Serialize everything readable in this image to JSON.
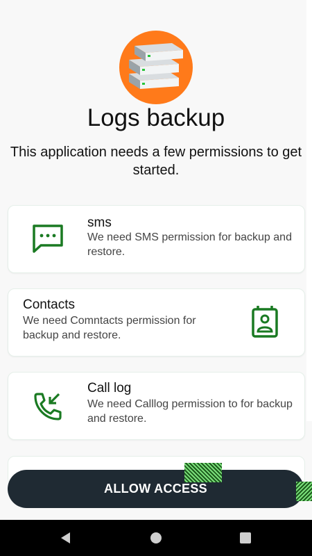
{
  "header": {
    "title": "Logs backup",
    "subtitle": "This application needs a few  permissions to get started.",
    "logo_icon": "server-stack-icon",
    "logo_color": "#ff7a1a"
  },
  "permissions": [
    {
      "title": "sms",
      "description": "We need SMS permission for backup and restore.",
      "icon": "sms-icon"
    },
    {
      "title": "Contacts",
      "description": "We need Comntacts permission for backup and restore.",
      "icon": "contact-card-icon"
    },
    {
      "title": "Call log",
      "description": "We need Calllog permission to for backup and restore.",
      "icon": "call-log-icon"
    }
  ],
  "primary_action": {
    "label": "ALLOW ACCESS"
  },
  "navigation": {
    "back": "back-icon",
    "home": "home-icon",
    "recents": "recents-icon"
  },
  "colors": {
    "accent_green": "#1a7a22",
    "button_dark": "#1f2a33",
    "logo_orange": "#ff7a1a"
  }
}
